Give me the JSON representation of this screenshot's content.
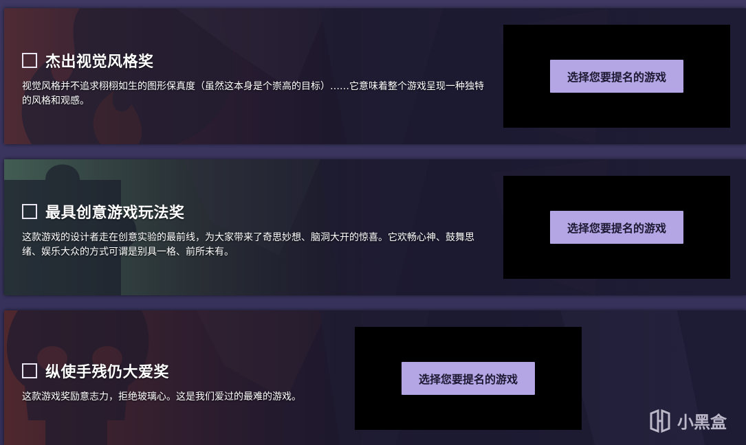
{
  "categories": [
    {
      "title": "杰出视觉风格奖",
      "description": "视觉风格并不追求栩栩如生的图形保真度（虽然这本身是个崇高的目标）……它意味着整个游戏呈现一种独特的风格和观感。",
      "button_label": "选择您要提名的游戏",
      "icon": "flame-icon"
    },
    {
      "title": "最具创意游戏玩法奖",
      "description": "这款游戏的设计者走在创意实验的最前线，为大家带来了奇思妙想、脑洞大开的惊喜。它欢畅心神、鼓舞思绪、娱乐大众的方式可谓是别具一格、前所未有。",
      "button_label": "选择您要提名的游戏",
      "icon": "puzzle-icon"
    },
    {
      "title": "纵使手残仍大爱奖",
      "description": "这款游戏奖励意志力，拒绝玻璃心。这是我们爱过的最难的游戏。",
      "button_label": "选择您要提名的游戏",
      "icon": "skull-icon"
    }
  ],
  "watermark": {
    "label": "小黑盒"
  },
  "colors": {
    "button_bg": "#b4a6e4",
    "slot_bg": "#000000",
    "page_bg": "#3a3458"
  }
}
